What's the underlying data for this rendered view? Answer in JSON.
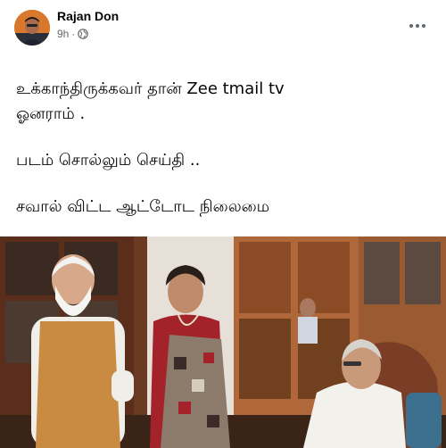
{
  "post": {
    "author_name": "Rajan Don",
    "time": "9h",
    "visibility_icon": "globe-icon",
    "menu_icon": "more-options-icon",
    "lines": [
      "உக்காந்திருக்கவர் தான் Zee tmail tv\nஓனராம் .",
      "படம் சொல்லும் செய்தி ..",
      "சவால் விட்ட ஆட்டோட நிலைமை"
    ],
    "image": {
      "description_icon": "photo-image"
    }
  },
  "colors": {
    "text": "#050505",
    "secondary": "#65676b",
    "background": "#ffffff"
  }
}
